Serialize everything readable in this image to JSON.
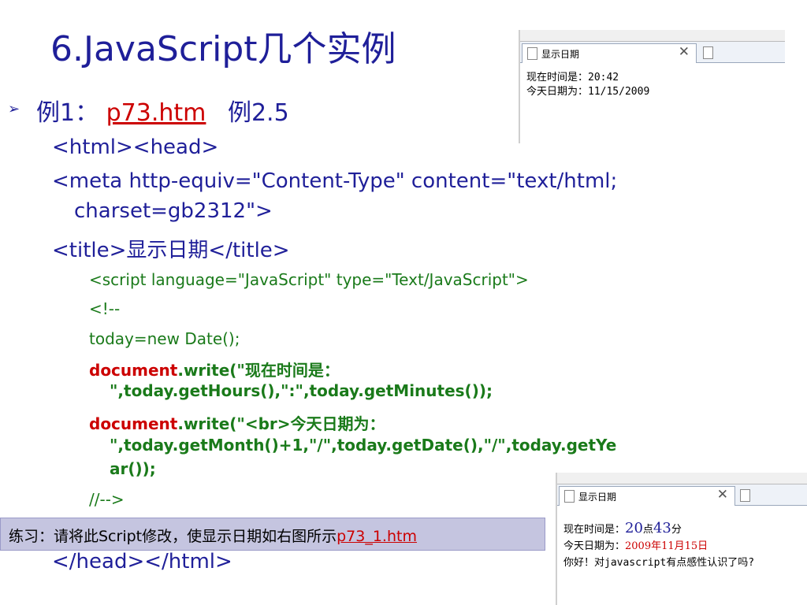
{
  "slide": {
    "title": "6.JavaScript几个实例",
    "bullet_symbol": "➢",
    "example_label": "例1：",
    "example_link": "p73.htm",
    "example_ref": "例2.5"
  },
  "code": {
    "l1": "<html><head>",
    "l2a": "<meta http-equiv=\"Content-Type\" content=\"text/html;",
    "l2b": "charset=gb2312\">",
    "l3a": "<title>",
    "l3b": "显示日期",
    "l3c": "</title>",
    "l4": "<script language=\"JavaScript\" type=\"Text/JavaScript\">",
    "l5": "<!--",
    "l6": "today=new Date();",
    "l7a": "document",
    "l7b": ".write(\"现在时间是：",
    "l7c": "\",today.getHours(),\":\",today.getMinutes());",
    "l8a": "document",
    "l8b": ".write(\"<br>今天日期为：",
    "l8c": "\",today.getMonth()+1,\"/\",today.getDate(),\"/\",today.getYe",
    "l8d": "ar());",
    "l9": "//-->",
    "l10": "</head></html>"
  },
  "screenshot_top": {
    "tab_title": "显示日期",
    "close": "✕",
    "line1": "现在时间是：20:42",
    "line2": "今天日期为：11/15/2009"
  },
  "screenshot_bottom": {
    "tab_title": "显示日期",
    "close": "✕",
    "line1_prefix": "现在时间是：",
    "hour": "20",
    "hour_unit": "点",
    "minute": "43",
    "minute_unit": "分",
    "line2_prefix": "今天日期为：",
    "date": "2009年11月15日",
    "line3": "你好！对javascript有点感性认识了吗?"
  },
  "exercise": {
    "text": "练习：请将此Script修改，使显示日期如右图所示",
    "link": "p73_1.htm"
  },
  "colors": {
    "title": "#1f1f99",
    "link": "#cc0000",
    "code_green": "#1a7a1a",
    "exercise_bg": "#c5c5e0"
  }
}
